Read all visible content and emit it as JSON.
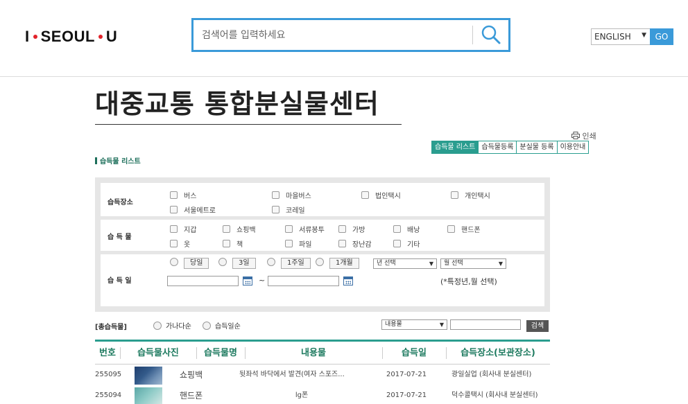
{
  "header": {
    "logo_left": "I",
    "logo_mid": "SEOUL",
    "logo_right": "U",
    "search_placeholder": "검색어를 입력하세요",
    "language": "ENGLISH",
    "go_label": "GO"
  },
  "page": {
    "title": "대중교통 통합분실물센터",
    "print_label": "인쇄",
    "tabs": [
      {
        "label": "습득물 리스트",
        "active": true
      },
      {
        "label": "습득물등록",
        "active": false
      },
      {
        "label": "분실물 등록",
        "active": false
      },
      {
        "label": "이용안내",
        "active": false
      }
    ],
    "section_label": "습득물 리스트"
  },
  "filters": {
    "place_label": "습득장소",
    "places": [
      "버스",
      "마을버스",
      "법인택시",
      "개인택시",
      "서울메트로",
      "코레일"
    ],
    "item_label": "습 득 물",
    "items": [
      "지갑",
      "쇼핑백",
      "서류봉투",
      "가방",
      "배낭",
      "핸드폰",
      "옷",
      "책",
      "파일",
      "장난감",
      "기타"
    ],
    "date_label": "습 득 일",
    "period_buttons": [
      "당일",
      "3일",
      "1주일",
      "1개월"
    ],
    "year_select": "년 선택",
    "month_select": "월 선택",
    "date_sep": "~",
    "date_note": "(*특정년,월 선택)"
  },
  "list_controls": {
    "total_label": "[총습득물]",
    "order_abc": "가나다순",
    "order_date": "습득일순",
    "kw_select": "내용물",
    "search_label": "검색"
  },
  "table": {
    "headers": [
      "번호",
      "습득물사진",
      "습득물명",
      "내용물",
      "습득일",
      "습득장소(보관장소)"
    ],
    "rows": [
      {
        "no": "255095",
        "name": "쇼핑백",
        "content": "뒷좌석 바닥에서 발견(여자 스포즈...",
        "date": "2017-07-21",
        "place": "광일실업 (회사내 분실센터)"
      },
      {
        "no": "255094",
        "name": "핸드폰",
        "content": "lg폰",
        "date": "2017-07-21",
        "place": "덕수콜택시 (회사내 분실센터)"
      }
    ]
  },
  "colors": {
    "accent_blue": "#3a9ad9",
    "teal": "#2a9d8f",
    "logo_dot": "#e2232a"
  }
}
